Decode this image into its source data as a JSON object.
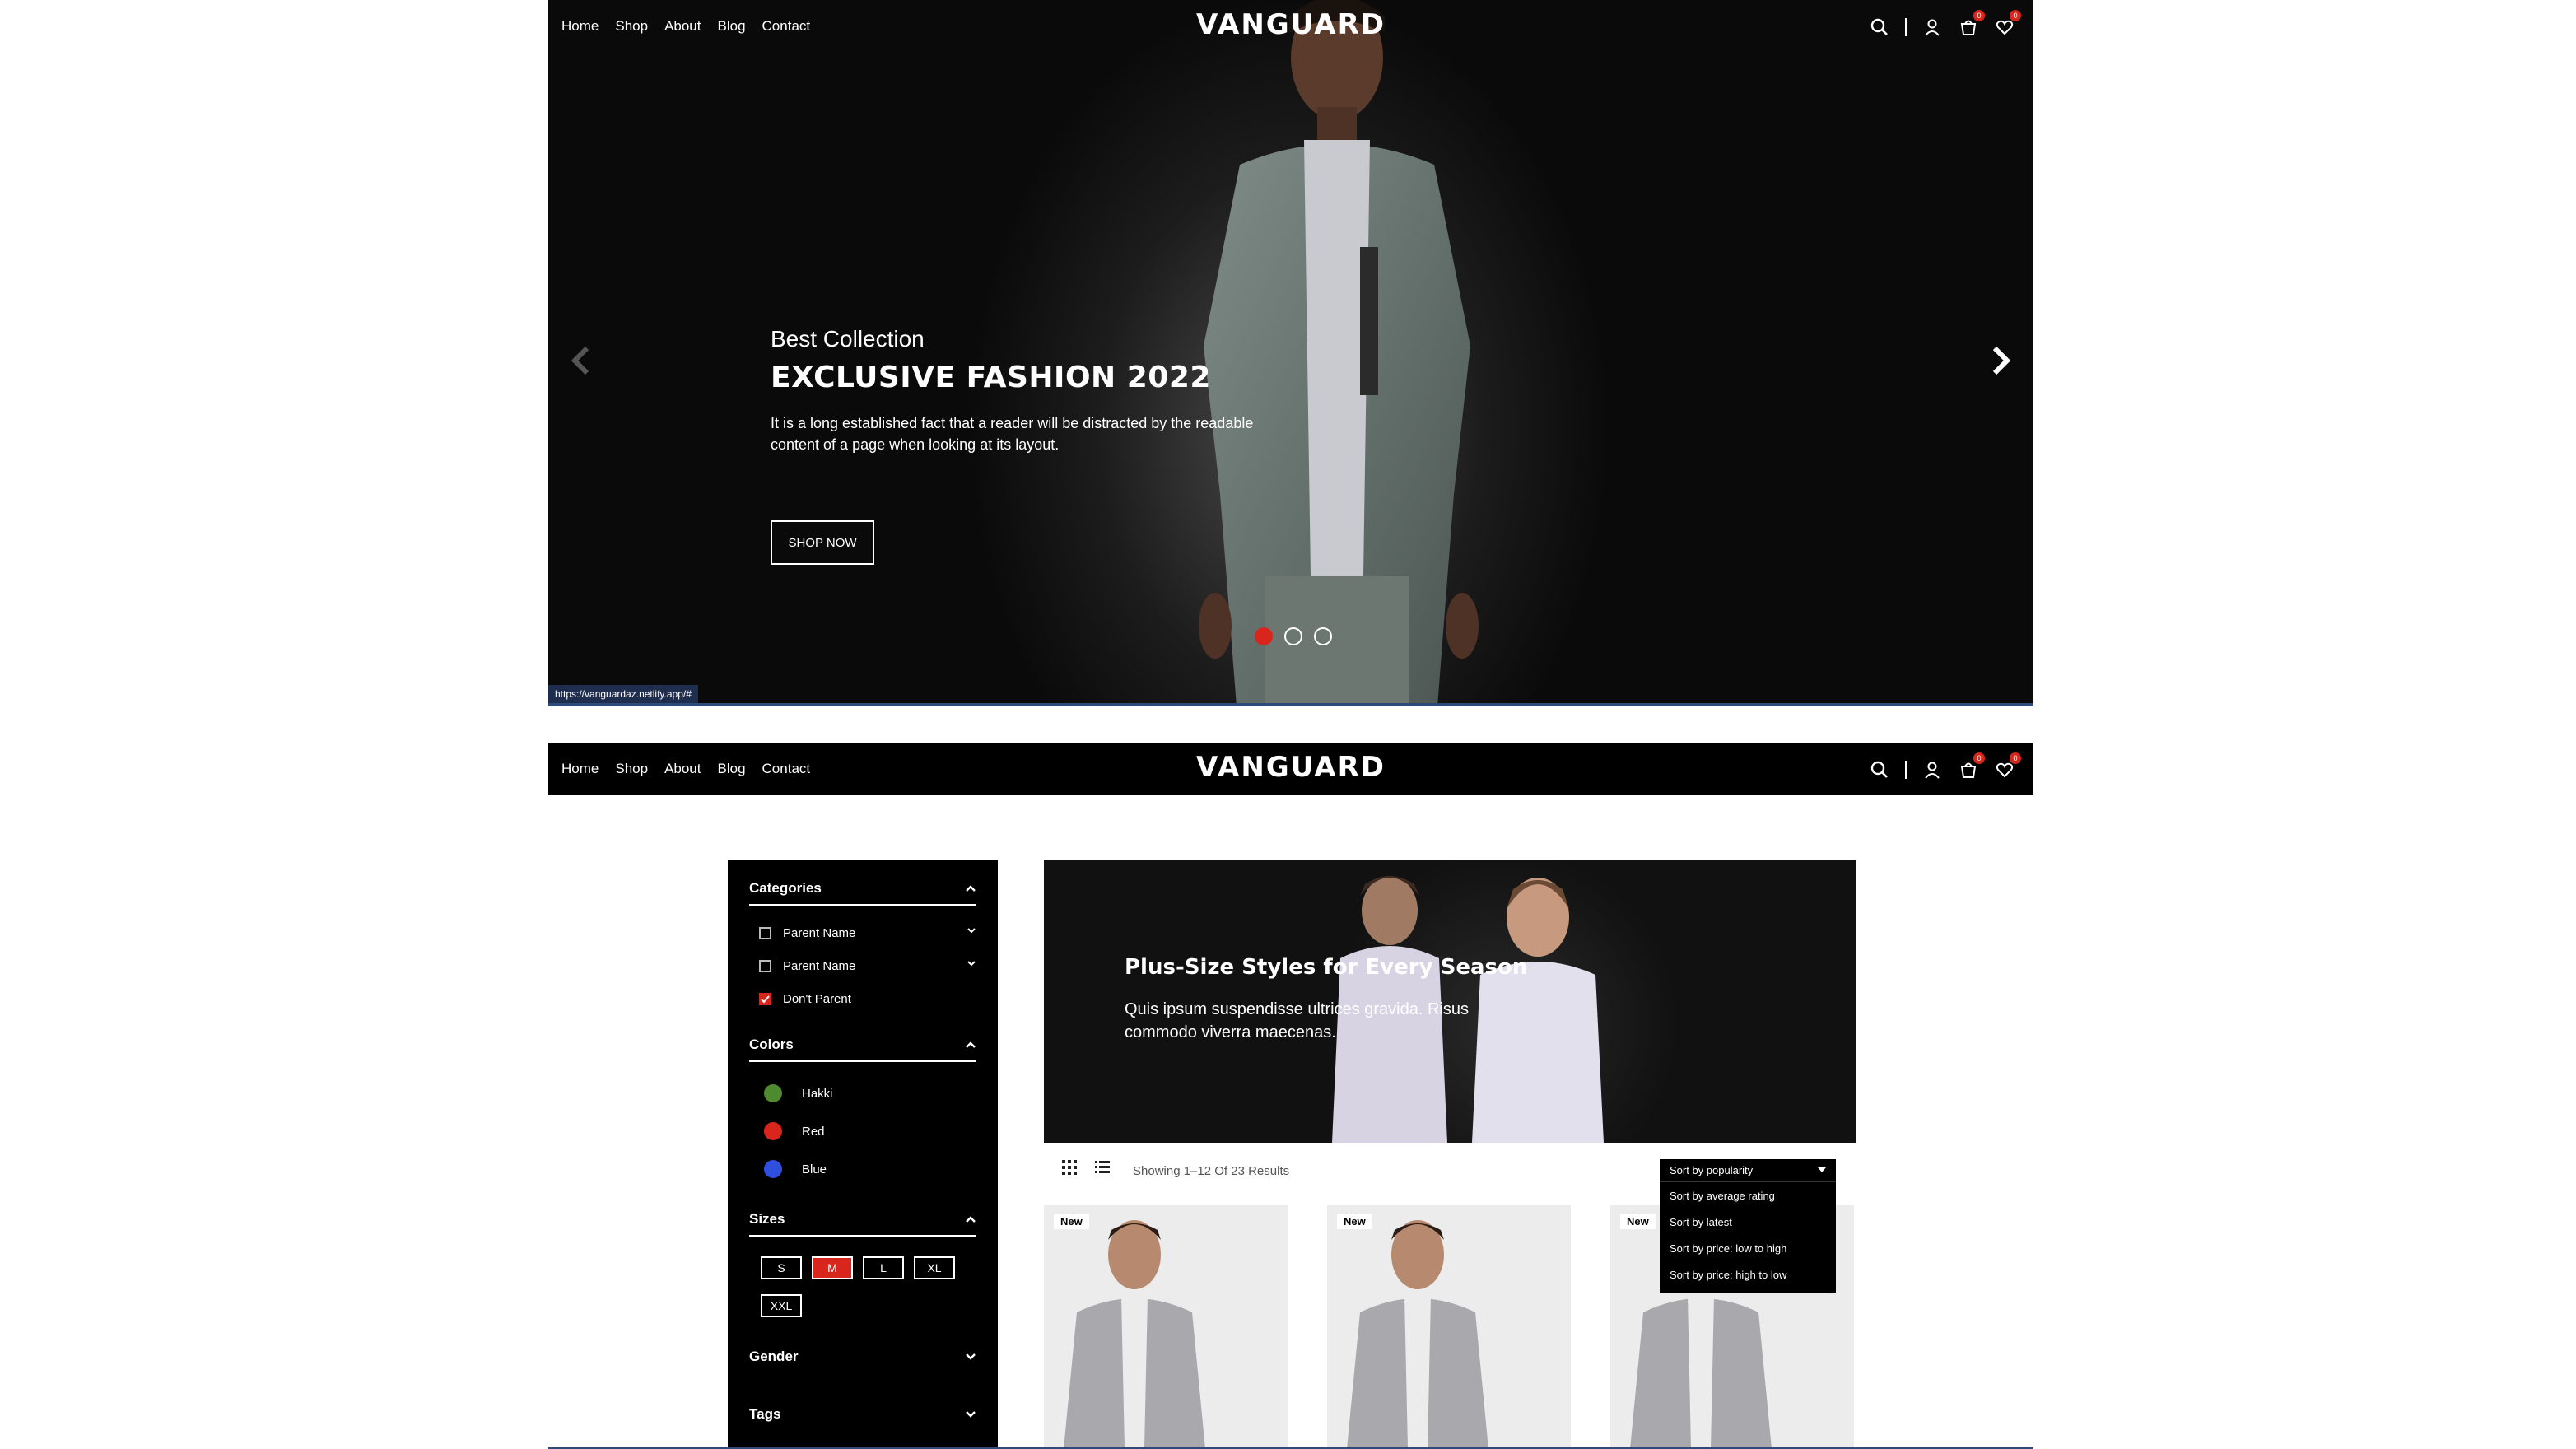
{
  "brand": "VANGUARD",
  "nav": [
    "Home",
    "Shop",
    "About",
    "Blog",
    "Contact"
  ],
  "header_icons": {
    "search": "search-icon",
    "user": "user-icon",
    "cart": "cart-icon",
    "wishlist": "heart-icon",
    "cart_count": "0",
    "wishlist_count": "0"
  },
  "hero": {
    "subtitle": "Best Collection",
    "title": "EXCLUSIVE FASHION 2022",
    "description": "It is a long established fact that a reader will be distracted by the readable content of a page when looking at its layout.",
    "cta": "SHOP NOW",
    "slides": 3,
    "active_slide": 1
  },
  "status_url": "https://vanguardaz.netlify.app/#",
  "filters": {
    "categories": {
      "title": "Categories",
      "items": [
        {
          "label": "Parent Name",
          "checked": false
        },
        {
          "label": "Parent Name",
          "checked": false
        },
        {
          "label": "Don't Parent",
          "checked": true
        }
      ]
    },
    "colors": {
      "title": "Colors",
      "items": [
        {
          "label": "Hakki",
          "hex": "#4f8a2f"
        },
        {
          "label": "Red",
          "hex": "#d9261c"
        },
        {
          "label": "Blue",
          "hex": "#2f4fdc"
        }
      ]
    },
    "sizes": {
      "title": "Sizes",
      "items": [
        "S",
        "M",
        "L",
        "XL",
        "XXL"
      ],
      "selected": "M"
    },
    "gender": {
      "title": "Gender"
    },
    "tags": {
      "title": "Tags"
    }
  },
  "banner": {
    "title": "Plus-Size Styles for Every Season",
    "description": "Quis ipsum suspendisse ultrices gravida. Risus commodo viverra maecenas."
  },
  "toolbar": {
    "results": "Showing 1–12 Of 23 Results",
    "sort_selected": "Sort by popularity",
    "sort_options": [
      "Sort by average rating",
      "Sort by latest",
      "Sort by price: low to high",
      "Sort by price: high to low"
    ]
  },
  "products": [
    {
      "badge": "New"
    },
    {
      "badge": "New"
    },
    {
      "badge": "New"
    }
  ],
  "colors": {
    "accent": "#d9261c",
    "dark": "#000000",
    "frame_line": "#2e4a7a"
  }
}
